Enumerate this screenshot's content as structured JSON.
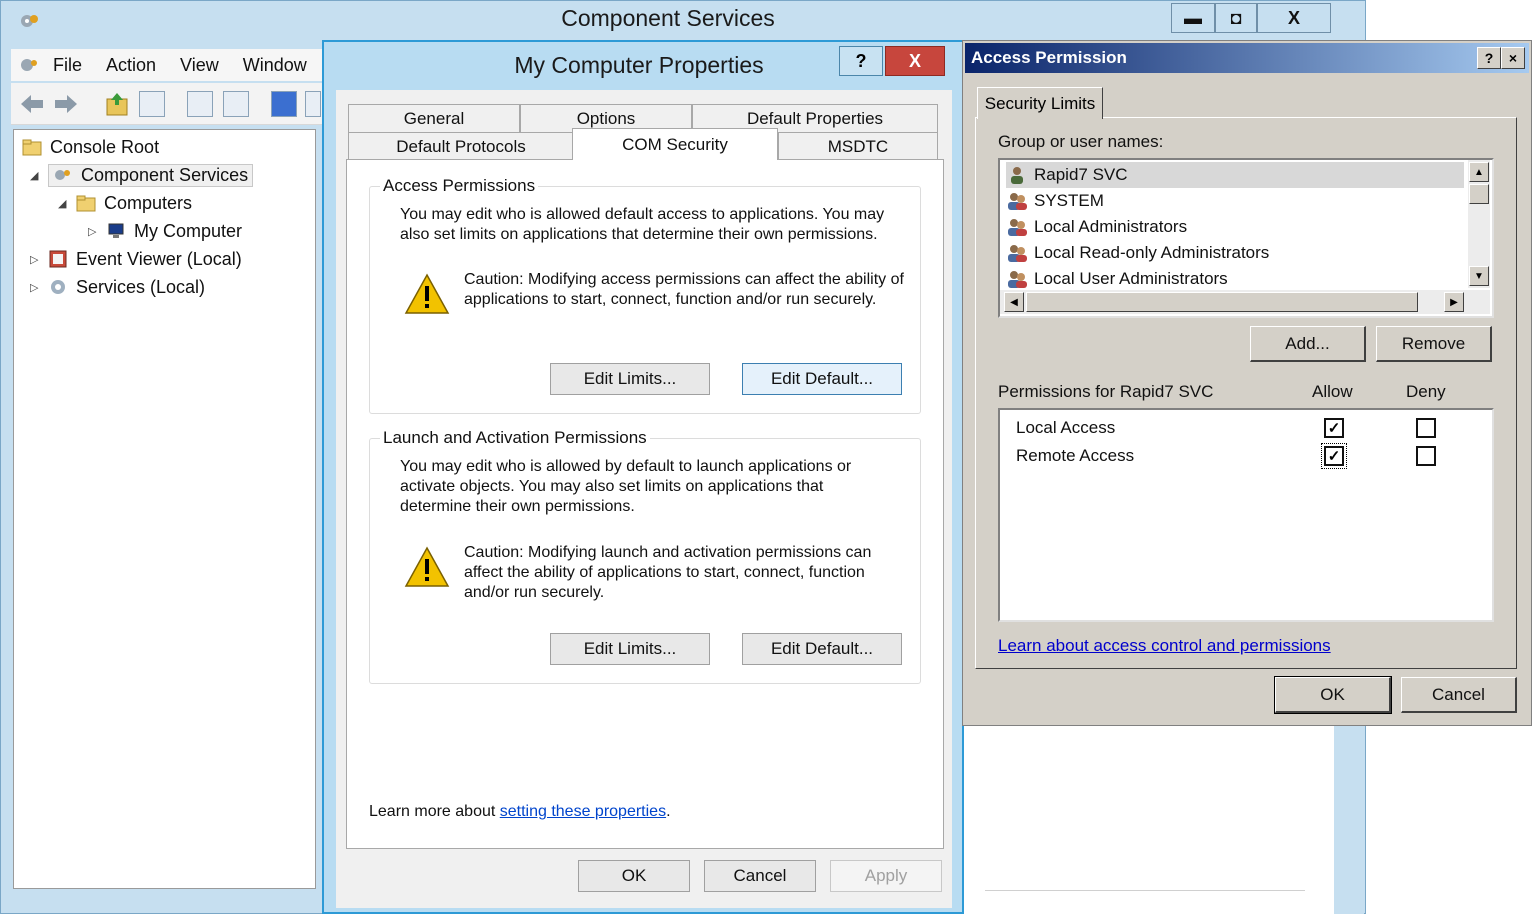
{
  "component_services": {
    "title": "Component Services",
    "caption": {
      "minimize": "▬",
      "maximize": "◘",
      "close": "X"
    },
    "menu": [
      "File",
      "Action",
      "View",
      "Window"
    ],
    "tree": [
      {
        "label": "Console Root"
      },
      {
        "label": "Component Services"
      },
      {
        "label": "Computers"
      },
      {
        "label": "My Computer"
      },
      {
        "label": "Event Viewer (Local)"
      },
      {
        "label": "Services (Local)"
      }
    ]
  },
  "properties": {
    "title": "My Computer Properties",
    "help": "?",
    "close": "X",
    "tabs": [
      "General",
      "Options",
      "Default Properties",
      "Default Protocols",
      "COM Security",
      "MSDTC"
    ],
    "access": {
      "title": "Access Permissions",
      "text": "You may edit who is allowed default access to applications. You may also set limits on applications that determine their own permissions.",
      "caution": "Caution: Modifying access permissions can affect the ability of applications to start, connect, function and/or run securely.",
      "edit_limits": "Edit Limits...",
      "edit_default": "Edit Default..."
    },
    "launch": {
      "title": "Launch and Activation Permissions",
      "text": "You may edit who is allowed by default to launch applications or activate objects. You may also set limits on applications that determine their own permissions.",
      "caution": "Caution: Modifying launch and activation permissions can affect the ability of applications to start, connect, function and/or run securely.",
      "edit_limits": "Edit Limits...",
      "edit_default": "Edit Default..."
    },
    "learn_prefix": "Learn more about ",
    "learn_link": "setting these properties",
    "learn_suffix": ".",
    "ok": "OK",
    "cancel": "Cancel",
    "apply": "Apply"
  },
  "access_permission": {
    "title": "Access Permission",
    "help": "?",
    "close": "×",
    "tab": "Security Limits",
    "group_label": "Group or user names:",
    "users": [
      "Rapid7 SVC",
      "SYSTEM",
      "Local Administrators",
      "Local Read-only Administrators",
      "Local User Administrators"
    ],
    "add": "Add...",
    "remove": "Remove",
    "perm_label": "Permissions for Rapid7 SVC",
    "allow": "Allow",
    "deny": "Deny",
    "permissions": [
      {
        "name": "Local Access",
        "allow": true,
        "deny": false
      },
      {
        "name": "Remote Access",
        "allow": true,
        "deny": false
      }
    ],
    "link": "Learn about access control and permissions",
    "ok": "OK",
    "cancel": "Cancel"
  }
}
